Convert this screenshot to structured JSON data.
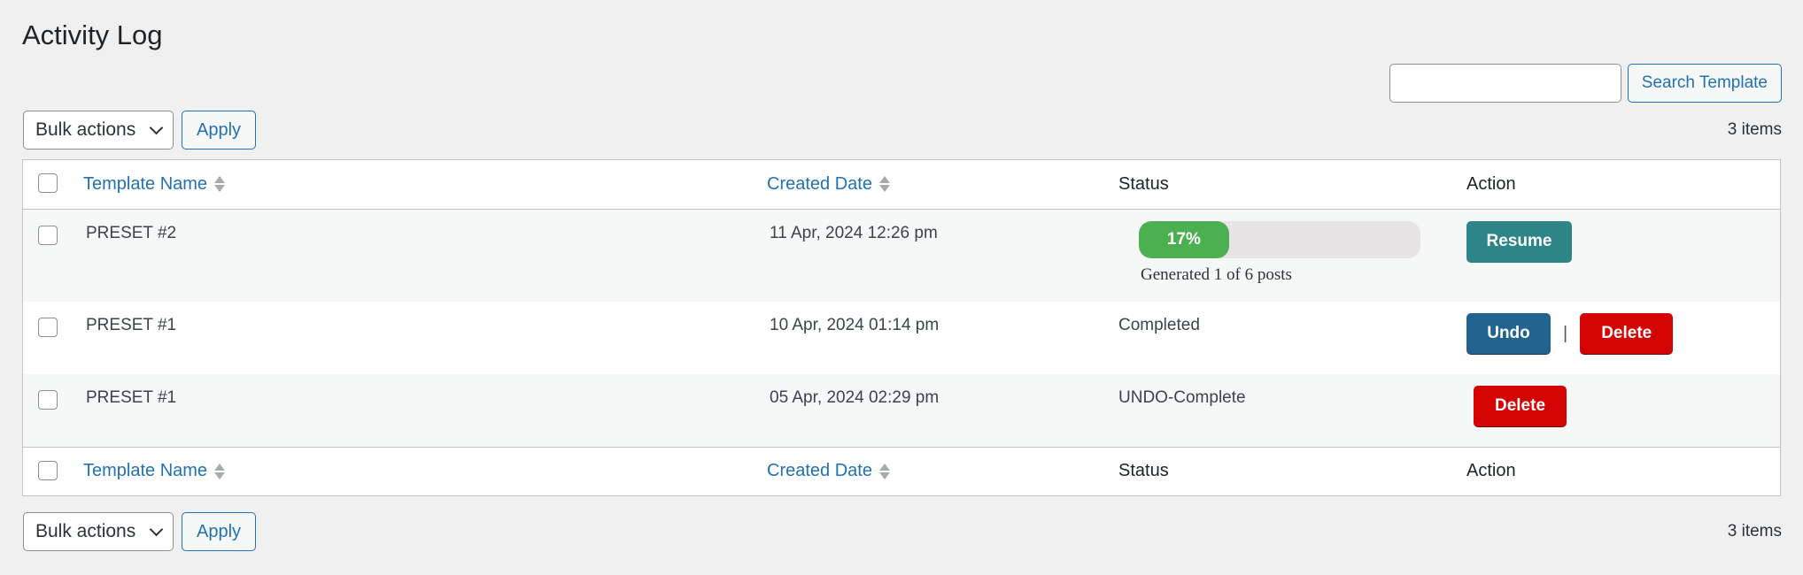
{
  "page": {
    "title": "Activity Log"
  },
  "search": {
    "value": "",
    "placeholder": "",
    "button_label": "Search Template"
  },
  "tablenav": {
    "bulk_actions_label": "Bulk actions",
    "apply_label": "Apply",
    "items_count": "3 items"
  },
  "table": {
    "columns": {
      "template_name": "Template Name",
      "created_date": "Created Date",
      "status": "Status",
      "action": "Action"
    },
    "rows": [
      {
        "name": "PRESET #2",
        "created_date": "11 Apr, 2024 12:26 pm",
        "status": {
          "type": "progress",
          "progress_percent": 17,
          "progress_label": "17%",
          "caption": "Generated 1 of 6 posts"
        },
        "actions": {
          "resume": "Resume"
        }
      },
      {
        "name": "PRESET #1",
        "created_date": "10 Apr, 2024 01:14 pm",
        "status": {
          "type": "text",
          "text": "Completed"
        },
        "actions": {
          "undo": "Undo",
          "separator": "|",
          "delete": "Delete"
        }
      },
      {
        "name": "PRESET #1",
        "created_date": "05 Apr, 2024 02:29 pm",
        "status": {
          "type": "text",
          "text": "UNDO-Complete"
        },
        "actions": {
          "delete": "Delete"
        }
      }
    ]
  },
  "colors": {
    "link": "#2271b1",
    "progress_fill": "#4caf50",
    "progress_track": "#e6e4e5",
    "resume": "#2e8587",
    "undo": "#22638f",
    "delete": "#d40404"
  }
}
